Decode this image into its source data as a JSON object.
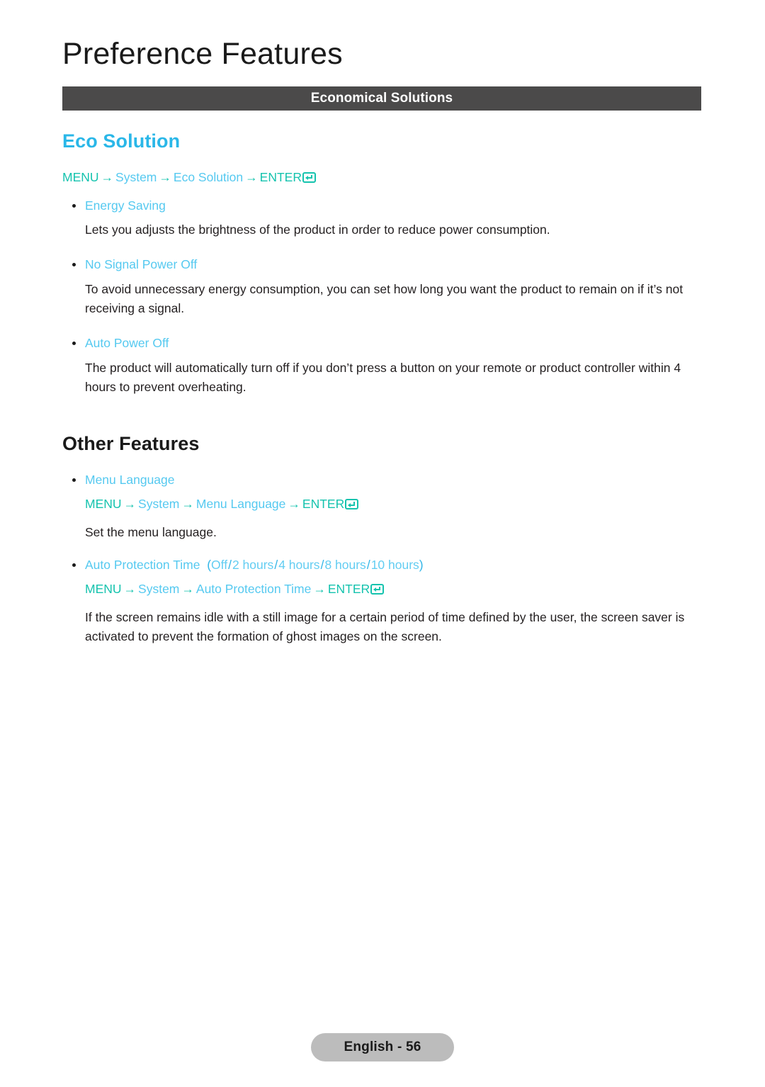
{
  "chapter": {
    "title": "Preference Features"
  },
  "section_bar": {
    "label": "Economical Solutions"
  },
  "sections": [
    {
      "heading": "Eco Solution",
      "heading_style": "blue"
    },
    {
      "heading": "Other Features",
      "heading_style": "black"
    }
  ],
  "eco_solution": {
    "heading": "Eco Solution",
    "menu_path": {
      "menu": "MENU",
      "arrow": "→",
      "step1": "System",
      "step2": "Eco Solution",
      "enter": "ENTER",
      "enter_icon": "enter-key-icon"
    },
    "items": [
      {
        "label": "Energy Saving",
        "description": "Lets you adjusts the brightness of the product in order to reduce power consumption."
      },
      {
        "label": "No Signal Power Off",
        "description": "To avoid unnecessary energy consumption, you can set how long you want the product to remain on if it’s not receiving a signal."
      },
      {
        "label": "Auto Power Off",
        "description": "The product will automatically turn off if you don’t press a button on your remote or product controller within 4 hours to prevent overheating."
      }
    ]
  },
  "other_features": {
    "heading": "Other Features",
    "menu_language": {
      "label": "Menu Language",
      "menu_path": {
        "menu": "MENU",
        "arrow": "→",
        "step1": "System",
        "step2": "Menu Language",
        "enter": "ENTER",
        "enter_icon": "enter-key-icon"
      },
      "description": "Set the menu language."
    },
    "auto_protection_time": {
      "label": "Auto Protection Time",
      "paren_open": "(",
      "paren_close": ")",
      "separator": "/",
      "options": [
        "Off",
        "2 hours",
        "4 hours",
        "8 hours",
        "10 hours"
      ],
      "menu_path": {
        "menu": "MENU",
        "arrow": "→",
        "step1": "System",
        "step2": "Auto Protection Time",
        "enter": "ENTER",
        "enter_icon": "enter-key-icon"
      },
      "description": "If the screen remains idle with a still image for a certain period of time defined by the user, the screen saver is activated to prevent the formation of ghost images on the screen."
    }
  },
  "footer": {
    "page_label": "English - 56"
  },
  "colors": {
    "accent_blue": "#2ab7e8",
    "light_blue": "#55c9f0",
    "teal": "#15c3ae",
    "bar_gray": "#4b4a4a",
    "pill_gray": "#bcbcbc",
    "body_text": "#231f20"
  }
}
